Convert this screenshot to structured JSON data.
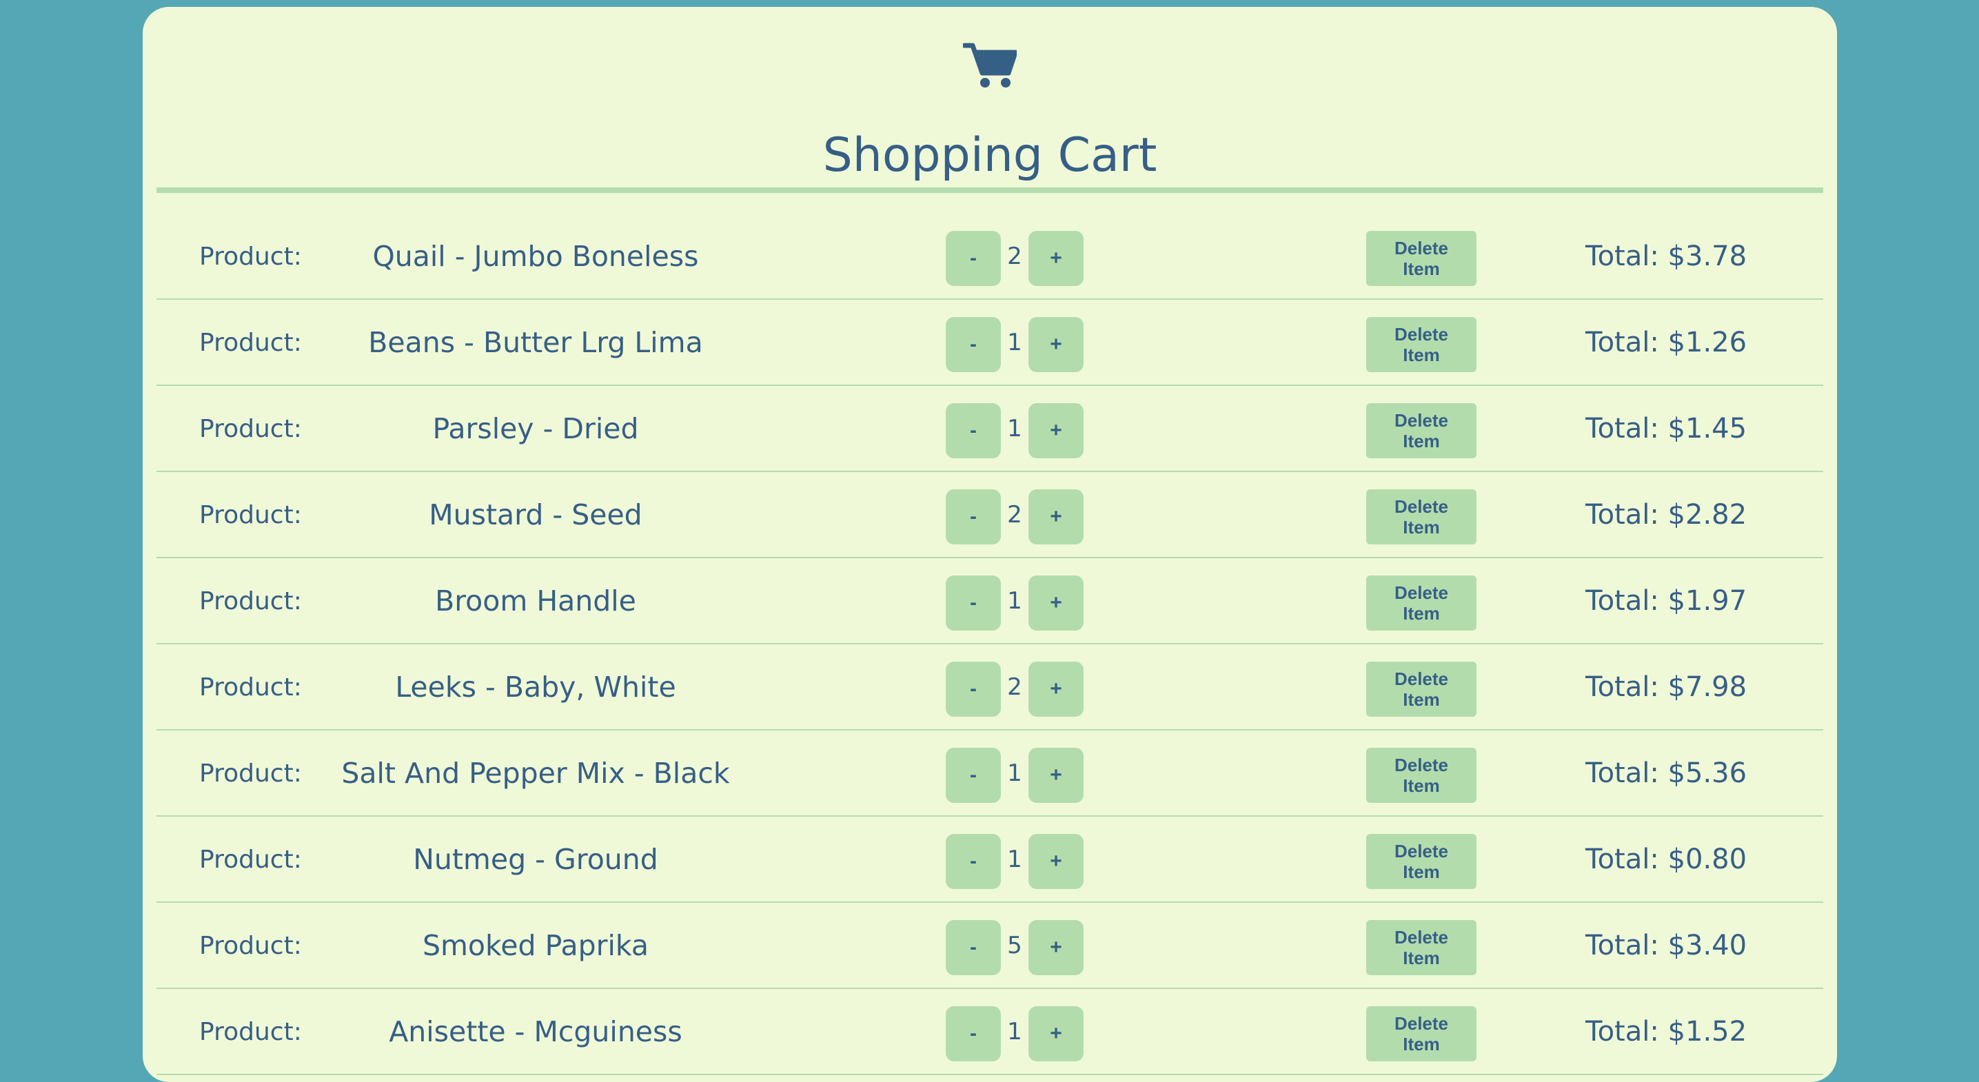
{
  "header": {
    "icon": "shopping-cart-icon",
    "title": "Shopping Cart"
  },
  "colors": {
    "page_background": "#55a7b5",
    "card_background": "#f0f9d7",
    "accent": "#b3dcad",
    "text": "#365f86"
  },
  "labels": {
    "product": "Product:",
    "minus": "-",
    "plus": "+",
    "delete": "Delete Item"
  },
  "items": [
    {
      "name": "Quail - Jumbo Boneless",
      "quantity": "2",
      "total": "Total: $3.78"
    },
    {
      "name": "Beans - Butter Lrg Lima",
      "quantity": "1",
      "total": "Total: $1.26"
    },
    {
      "name": "Parsley - Dried",
      "quantity": "1",
      "total": "Total: $1.45"
    },
    {
      "name": "Mustard - Seed",
      "quantity": "2",
      "total": "Total: $2.82"
    },
    {
      "name": "Broom Handle",
      "quantity": "1",
      "total": "Total: $1.97"
    },
    {
      "name": "Leeks - Baby, White",
      "quantity": "2",
      "total": "Total: $7.98"
    },
    {
      "name": "Salt And Pepper Mix - Black",
      "quantity": "1",
      "total": "Total: $5.36"
    },
    {
      "name": "Nutmeg - Ground",
      "quantity": "1",
      "total": "Total: $0.80"
    },
    {
      "name": "Smoked Paprika",
      "quantity": "5",
      "total": "Total: $3.40"
    },
    {
      "name": "Anisette - Mcguiness",
      "quantity": "1",
      "total": "Total: $1.52"
    }
  ]
}
